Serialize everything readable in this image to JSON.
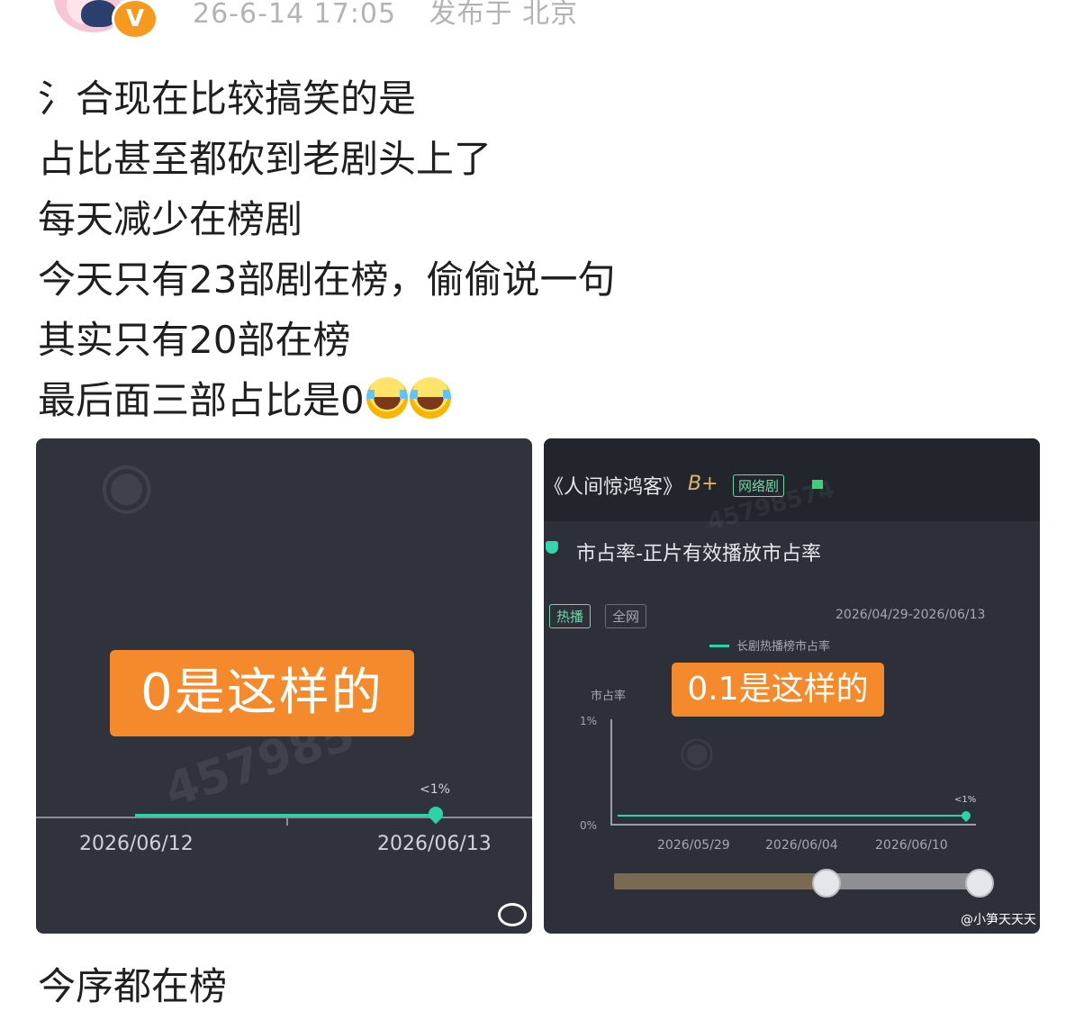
{
  "header": {
    "timestamp": "26-6-14 17:05",
    "location": "发布于 北京",
    "verified_badge": "V"
  },
  "post": {
    "lines": [
      "氵合现在比较搞笑的是",
      "占比甚至都砍到老剧头上了",
      "每天减少在榜剧",
      "今天只有23部剧在榜，偷偷说一句",
      "其实只有20部在榜",
      "最后面三部占比是0"
    ],
    "emoji": [
      "laugh-cry-emoji",
      "laugh-cry-emoji"
    ],
    "truncated_next_line": "今序都在榜"
  },
  "image1": {
    "overlay_label": "0是这样的",
    "value_label": "<1%",
    "x_dates": [
      "2026/06/12",
      "2026/06/13"
    ],
    "watermark": "457985"
  },
  "image2": {
    "drama_title": "《人间惊鸿客》",
    "grade": "B+",
    "type_tag": "网络剧",
    "section_title": "市占率-正片有效播放市占率",
    "chips": [
      "热播",
      "全网"
    ],
    "date_range": "2026/04/29-2026/06/13",
    "legend": "长剧热播榜市占率",
    "ylabel": "市占率",
    "y_ticks": [
      "1%",
      "0%"
    ],
    "overlay_label": "0.1是这样的",
    "value_label": "<1%",
    "x_dates": [
      "2026/05/29",
      "2026/06/04",
      "2026/06/10"
    ],
    "credit": "@小笋天天天",
    "watermark": "45798574"
  },
  "colors": {
    "accent_orange": "#f48a2c",
    "line_teal": "#2bd4a5",
    "chart_bg": "#30323c"
  }
}
